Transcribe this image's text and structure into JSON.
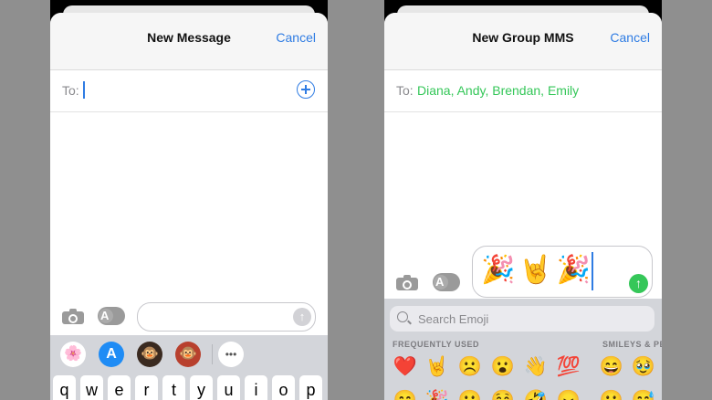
{
  "left": {
    "title": "New Message",
    "cancel": "Cancel",
    "to_label": "To:",
    "send_glyph": "↑",
    "app_strip": {
      "photos": "🌸",
      "app_store": "A",
      "memoji_1": "🐵",
      "memoji_2": "🐵",
      "more": "•••"
    },
    "keyboard_row": [
      "q",
      "w",
      "e",
      "r",
      "t",
      "y",
      "u",
      "i",
      "o",
      "p"
    ]
  },
  "right": {
    "title": "New Group MMS",
    "cancel": "Cancel",
    "to_label": "To:",
    "recipients": "Diana, Andy, Brendan, Emily",
    "message": "🎉🤘🎉",
    "send_glyph": "↑",
    "emoji_search_placeholder": "Search Emoji",
    "categories": {
      "frequently_used": "FREQUENTLY USED",
      "smileys": "SMILEYS & PE"
    },
    "emoji_rows": [
      [
        "❤️",
        "🤘",
        "☹️",
        "😮",
        "👋",
        "💯",
        "😄",
        "🥹"
      ],
      [
        "😄",
        "🎉",
        "😕",
        "😚",
        "🤣",
        "😠",
        "😀",
        "😅"
      ]
    ]
  },
  "colors": {
    "accent_blue": "#2f7ce3",
    "recipient_green": "#35c759"
  },
  "icons": [
    "camera-icon",
    "app-store-icon",
    "plus-circle-icon",
    "send-arrow-icon",
    "search-icon",
    "photos-icon"
  ]
}
